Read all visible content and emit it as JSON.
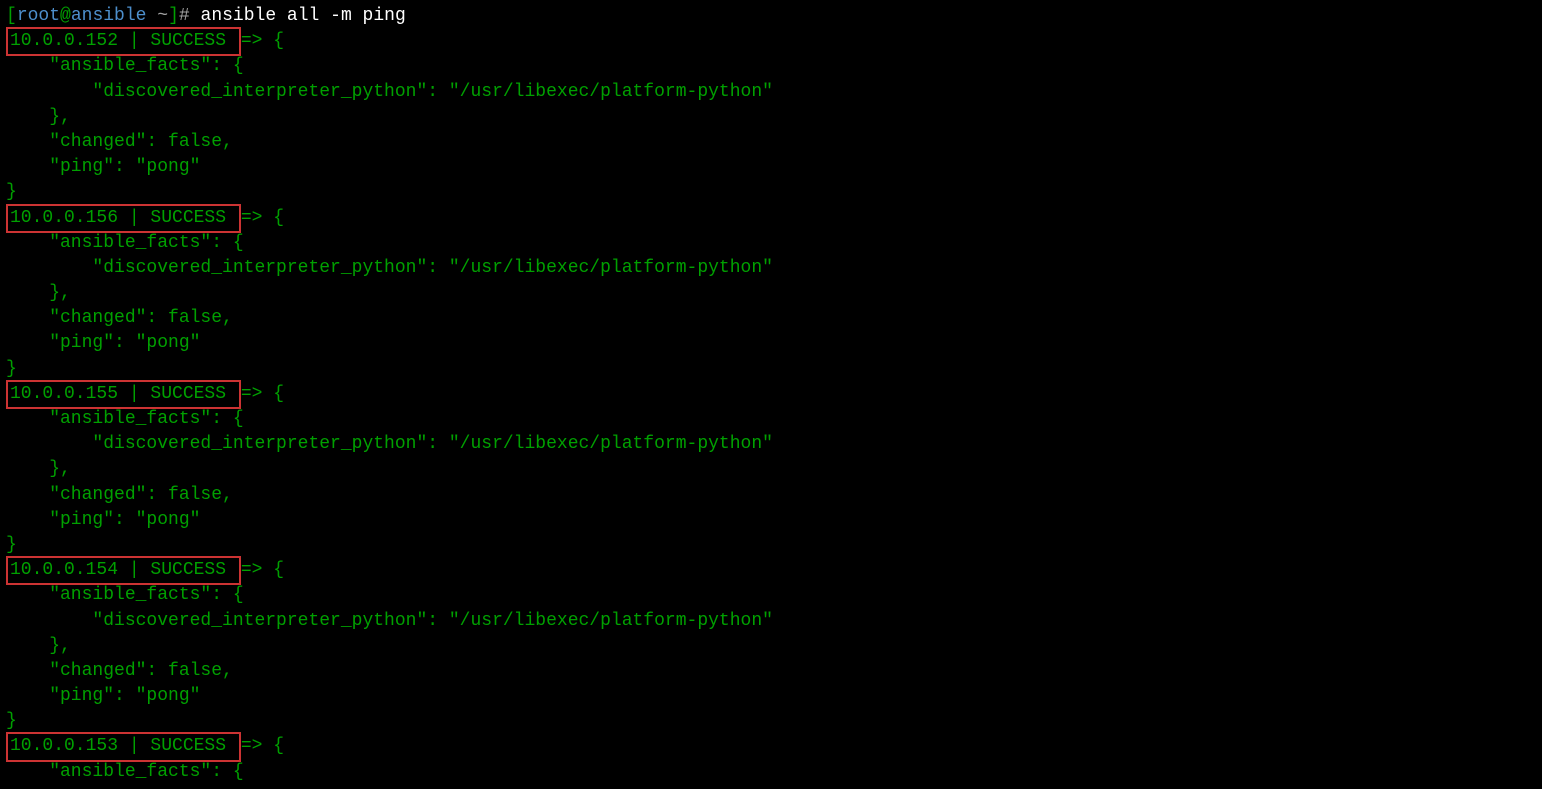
{
  "prompt": {
    "bracket_open": "[",
    "user": "root",
    "at": "@",
    "host": "ansible",
    "space": " ",
    "tilde": "~",
    "bracket_close": "]",
    "hash": "# ",
    "command": "ansible all -m ping"
  },
  "results": [
    {
      "header": "10.0.0.152 | SUCCESS ",
      "arrow": "=> {",
      "lines": [
        "    \"ansible_facts\": {",
        "        \"discovered_interpreter_python\": \"/usr/libexec/platform-python\"",
        "    },",
        "    \"changed\": false,",
        "    \"ping\": \"pong\"",
        "}"
      ]
    },
    {
      "header": "10.0.0.156 | SUCCESS ",
      "arrow": "=> {",
      "lines": [
        "    \"ansible_facts\": {",
        "        \"discovered_interpreter_python\": \"/usr/libexec/platform-python\"",
        "    },",
        "    \"changed\": false,",
        "    \"ping\": \"pong\"",
        "}"
      ]
    },
    {
      "header": "10.0.0.155 | SUCCESS ",
      "arrow": "=> {",
      "lines": [
        "    \"ansible_facts\": {",
        "        \"discovered_interpreter_python\": \"/usr/libexec/platform-python\"",
        "    },",
        "    \"changed\": false,",
        "    \"ping\": \"pong\"",
        "}"
      ]
    },
    {
      "header": "10.0.0.154 | SUCCESS ",
      "arrow": "=> {",
      "lines": [
        "    \"ansible_facts\": {",
        "        \"discovered_interpreter_python\": \"/usr/libexec/platform-python\"",
        "    },",
        "    \"changed\": false,",
        "    \"ping\": \"pong\"",
        "}"
      ]
    },
    {
      "header": "10.0.0.153 | SUCCESS ",
      "arrow": "=> {",
      "lines": [
        "    \"ansible_facts\": {"
      ]
    }
  ]
}
